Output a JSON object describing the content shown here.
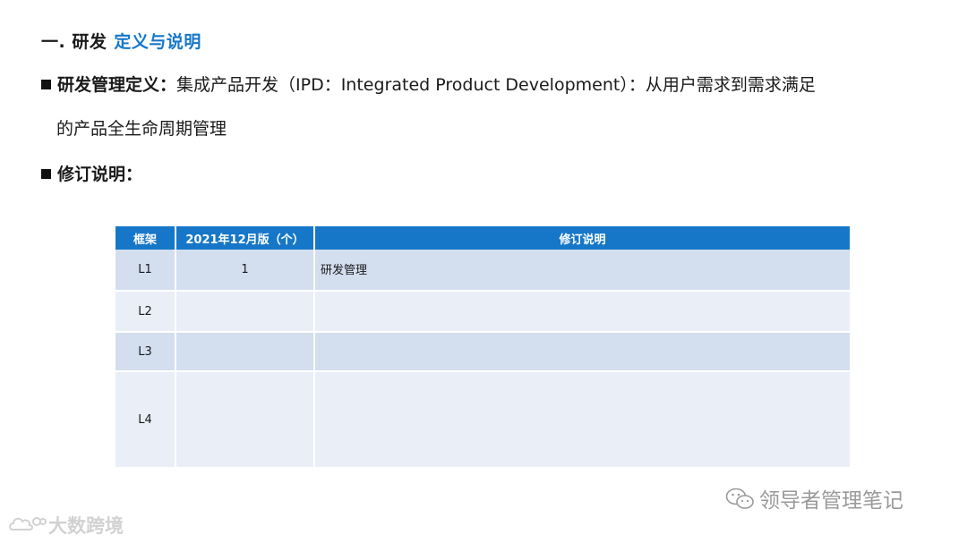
{
  "heading": {
    "prefix": "一. 研发",
    "accent": "定义与说明",
    "accent_color": "#1677c8"
  },
  "definition": {
    "label": "研发管理定义：",
    "text_line1": "集成产品开发（IPD：Integrated Product Development）：从用户需求到需求满足",
    "text_line2": "的产品全生命周期管理"
  },
  "revision": {
    "label": "修订说明："
  },
  "table": {
    "header_color": "#1677c8",
    "headers": [
      "框架",
      "2021年12月版（个）",
      "修订说明"
    ],
    "rows": [
      {
        "level": "L1",
        "count": "1",
        "note": "研发管理"
      },
      {
        "level": "L2",
        "count": "",
        "note": ""
      },
      {
        "level": "L3",
        "count": "",
        "note": ""
      },
      {
        "level": "L4",
        "count": "",
        "note": ""
      }
    ]
  },
  "footer": {
    "wechat_account": "领导者管理笔记",
    "wechat_icon": "wechat-icon",
    "watermark_text": "大数跨境",
    "watermark_icon": "cloud-logo-icon"
  }
}
